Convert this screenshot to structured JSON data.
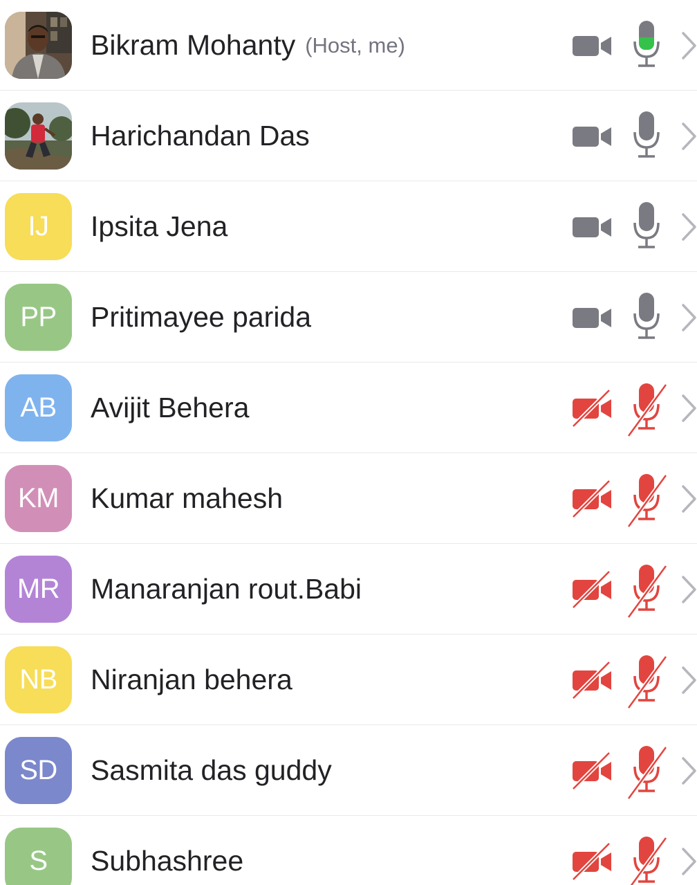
{
  "participants": [
    {
      "name": "Bikram Mohanty",
      "tag": "(Host, me)",
      "initials": "",
      "avatar_color": "",
      "avatar_type": "photo-man-indoor",
      "video": "on",
      "audio": "speaking",
      "icon_camera": "video-camera-icon",
      "icon_mic": "microphone-icon"
    },
    {
      "name": "Harichandan Das",
      "tag": "",
      "initials": "",
      "avatar_color": "",
      "avatar_type": "photo-outdoor",
      "video": "on",
      "audio": "on",
      "icon_camera": "video-camera-icon",
      "icon_mic": "microphone-icon"
    },
    {
      "name": "Ipsita Jena",
      "tag": "",
      "initials": "IJ",
      "avatar_color": "#f7dd58",
      "avatar_type": "initials",
      "video": "on",
      "audio": "on",
      "icon_camera": "video-camera-icon",
      "icon_mic": "microphone-icon"
    },
    {
      "name": "Pritimayee parida",
      "tag": "",
      "initials": "PP",
      "avatar_color": "#98c785",
      "avatar_type": "initials",
      "video": "on",
      "audio": "on",
      "icon_camera": "video-camera-icon",
      "icon_mic": "microphone-icon"
    },
    {
      "name": "Avijit Behera",
      "tag": "",
      "initials": "AB",
      "avatar_color": "#7fb3ee",
      "avatar_type": "initials",
      "video": "off",
      "audio": "muted",
      "icon_camera": "video-camera-off-icon",
      "icon_mic": "microphone-muted-icon"
    },
    {
      "name": "Kumar mahesh",
      "tag": "",
      "initials": "KM",
      "avatar_color": "#d18fb8",
      "avatar_type": "initials",
      "video": "off",
      "audio": "muted",
      "icon_camera": "video-camera-off-icon",
      "icon_mic": "microphone-muted-icon"
    },
    {
      "name": "Manaranjan rout.Babi",
      "tag": "",
      "initials": "MR",
      "avatar_color": "#b384d6",
      "avatar_type": "initials",
      "video": "off",
      "audio": "muted",
      "icon_camera": "video-camera-off-icon",
      "icon_mic": "microphone-muted-icon"
    },
    {
      "name": "Niranjan behera",
      "tag": "",
      "initials": "NB",
      "avatar_color": "#f7dd58",
      "avatar_type": "initials",
      "video": "off",
      "audio": "muted",
      "icon_camera": "video-camera-off-icon",
      "icon_mic": "microphone-muted-icon"
    },
    {
      "name": "Sasmita das guddy",
      "tag": "",
      "initials": "SD",
      "avatar_color": "#7c88cc",
      "avatar_type": "initials",
      "video": "off",
      "audio": "muted",
      "icon_camera": "video-camera-off-icon",
      "icon_mic": "microphone-muted-icon"
    },
    {
      "name": "Subhashree",
      "tag": "",
      "initials": "S",
      "avatar_color": "#98c785",
      "avatar_type": "initials",
      "video": "off",
      "audio": "muted",
      "icon_camera": "video-camera-off-icon",
      "icon_mic": "microphone-muted-icon"
    }
  ],
  "colors": {
    "icon_gray": "#7a7a82",
    "muted_red": "#e2453f",
    "speaking_green": "#34c24a",
    "chevron": "#b6b6bc",
    "name_text": "#222226",
    "tag_text": "#747480",
    "divider": "#e9e9ec"
  }
}
